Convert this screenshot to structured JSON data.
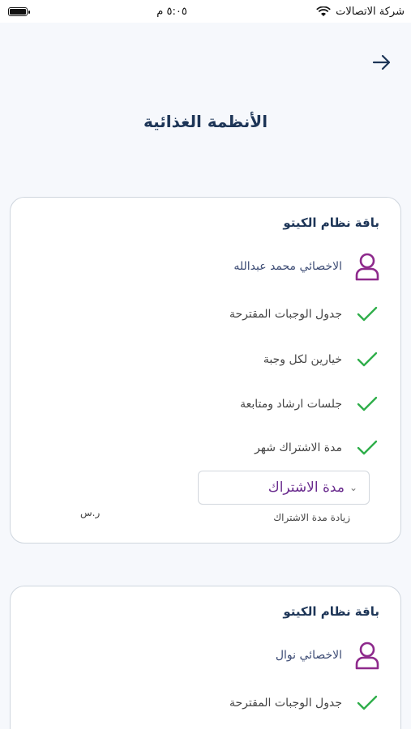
{
  "status_bar": {
    "carrier": "شركة الاتصالات",
    "time": "٥:٠٥ م"
  },
  "header": {
    "title": "الأنظمة الغذائية"
  },
  "cards": [
    {
      "title": "باقة نظام الكيتو",
      "specialist": "الاخصائي محمد عبدالله",
      "features": [
        "جدول الوجبات المقترحة",
        "خيارين لكل وجبة",
        "جلسات ارشاد ومتابعة",
        "مدة الاشتراك شهر"
      ],
      "dropdown_value": "مدة الاشتراك",
      "increase_label": "زيادة مدة الاشتراك",
      "currency": "ر.س"
    },
    {
      "title": "باقة نظام الكيتو",
      "specialist": "الاخصائي نوال",
      "features": [
        "جدول الوجبات المقترحة"
      ]
    }
  ],
  "colors": {
    "accent_purple": "#8e2a8c",
    "check_green": "#2fae4a",
    "title_navy": "#1d3557"
  }
}
